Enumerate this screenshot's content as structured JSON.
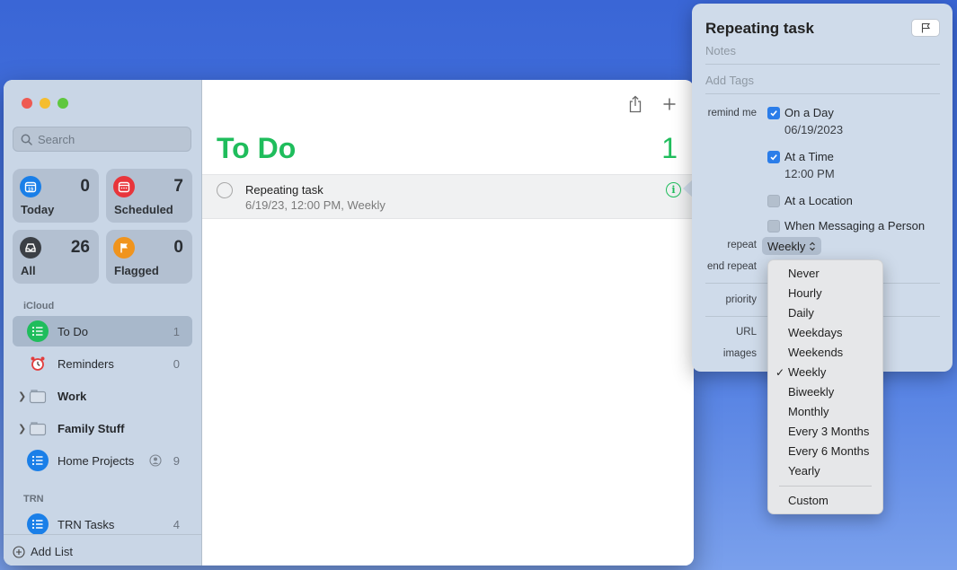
{
  "sidebar": {
    "search_placeholder": "Search",
    "smart_lists": [
      {
        "label": "Today",
        "count": "0",
        "color": "#1a7fe8"
      },
      {
        "label": "Scheduled",
        "count": "7",
        "color": "#e8353b"
      },
      {
        "label": "All",
        "count": "26",
        "color": "#3b3f45"
      },
      {
        "label": "Flagged",
        "count": "0",
        "color": "#f0941d"
      }
    ],
    "section_icloud": "iCloud",
    "section_trn": "TRN",
    "lists": [
      {
        "label": "To Do",
        "count": "1"
      },
      {
        "label": "Reminders",
        "count": "0"
      },
      {
        "label": "Work",
        "count": ""
      },
      {
        "label": "Family Stuff",
        "count": ""
      },
      {
        "label": "Home Projects",
        "count": "9"
      },
      {
        "label": "TRN Tasks",
        "count": "4"
      }
    ],
    "add_list_label": "Add List"
  },
  "main": {
    "title": "To Do",
    "count": "1",
    "accent_color": "#1fbd5c",
    "task": {
      "title": "Repeating task",
      "subtitle": "6/19/23, 12:00 PM, Weekly"
    }
  },
  "popover": {
    "title": "Repeating task",
    "notes_placeholder": "Notes",
    "tags_placeholder": "Add Tags",
    "remind_me_label": "remind me",
    "on_a_day_label": "On a Day",
    "on_a_day_value": "06/19/2023",
    "at_a_time_label": "At a Time",
    "at_a_time_value": "12:00 PM",
    "at_a_location_label": "At a Location",
    "when_messaging_label": "When Messaging a Person",
    "repeat_label": "repeat",
    "repeat_value": "Weekly",
    "end_repeat_label": "end repeat",
    "priority_label": "priority",
    "url_label": "URL",
    "images_label": "images"
  },
  "repeat_menu": {
    "items": [
      "Never",
      "Hourly",
      "Daily",
      "Weekdays",
      "Weekends",
      "Weekly",
      "Biweekly",
      "Monthly",
      "Every 3 Months",
      "Every 6 Months",
      "Yearly"
    ],
    "checked": "Weekly",
    "custom": "Custom"
  }
}
